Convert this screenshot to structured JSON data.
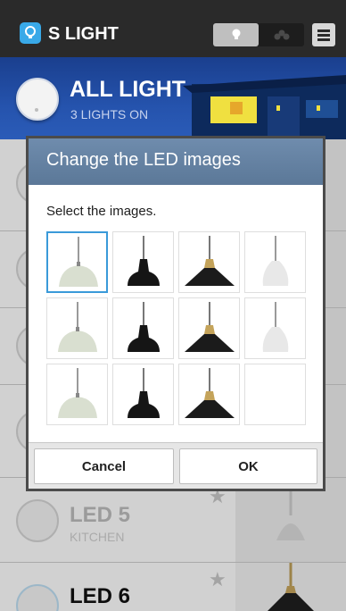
{
  "app": {
    "title": "S LIGHT",
    "accent": "#39a9e8",
    "icons": {
      "app": "bulb-icon",
      "mode_a": "bulb-icon",
      "mode_b": "cluster-icon",
      "menu": "menu-icon"
    }
  },
  "all_light": {
    "title": "ALL LIGHT",
    "status": "3 LIGHTS ON",
    "switch_icon": "power-switch-icon"
  },
  "list": [
    {
      "name": "LED 5",
      "room": "KITCHEN",
      "favorite_icon": "star-icon"
    },
    {
      "name": "LED 6",
      "room": "",
      "favorite_icon": "star-icon"
    }
  ],
  "dialog": {
    "title": "Change the LED images",
    "subtitle": "Select the images.",
    "selected_index": 0,
    "images": [
      {
        "style": "dome-white"
      },
      {
        "style": "bell-black"
      },
      {
        "style": "flat-black-gold"
      },
      {
        "style": "cone-white"
      },
      {
        "style": "dome-white"
      },
      {
        "style": "bell-black"
      },
      {
        "style": "flat-black-gold"
      },
      {
        "style": "cone-white"
      },
      {
        "style": "dome-white"
      },
      {
        "style": "bell-black"
      },
      {
        "style": "flat-black-gold"
      },
      {
        "style": "empty"
      }
    ],
    "cancel_label": "Cancel",
    "ok_label": "OK"
  }
}
